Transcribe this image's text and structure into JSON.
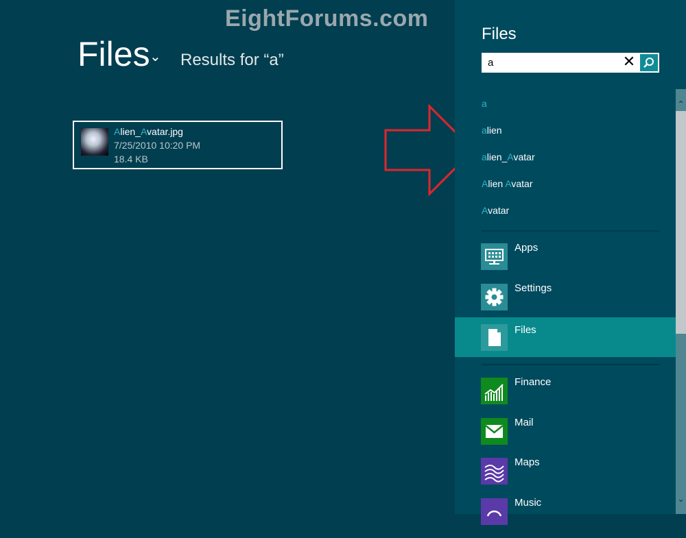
{
  "watermark": "EightForums.com",
  "main": {
    "title": "Files",
    "results_label": "Results for “a”",
    "file": {
      "name_hl1": "A",
      "name_mid": "lien_",
      "name_hl2": "A",
      "name_rest": "vatar.jpg",
      "date": "7/25/2010 10:20 PM",
      "size": "18.4 KB"
    }
  },
  "pane": {
    "title": "Files",
    "search_value": "a",
    "suggestions": [
      {
        "hl": "a",
        "rest": "",
        "hl2": "",
        "rest2": ""
      },
      {
        "hl": "a",
        "rest": "lien",
        "hl2": "",
        "rest2": ""
      },
      {
        "hl": "a",
        "rest": "lien_",
        "hl2": "A",
        "rest2": "vatar"
      },
      {
        "hl": "A",
        "rest": "lien ",
        "hl2": "A",
        "rest2": "vatar"
      },
      {
        "hl": "A",
        "rest": "vatar",
        "hl2": "",
        "rest2": ""
      }
    ],
    "targets": [
      {
        "label": "Apps",
        "icon": "apps-icon"
      },
      {
        "label": "Settings",
        "icon": "gear-icon"
      },
      {
        "label": "Files",
        "icon": "file-icon",
        "selected": true
      }
    ],
    "apps": [
      {
        "label": "Finance",
        "color": "#0f8a1e"
      },
      {
        "label": "Mail",
        "color": "#0f8a1e"
      },
      {
        "label": "Maps",
        "color": "#5a3aa8"
      },
      {
        "label": "Music",
        "color": "#5a3aa8"
      }
    ]
  },
  "colors": {
    "background": "#013e50",
    "pane": "#004a5e",
    "selected": "#088a8d",
    "highlight": "#2fb4c4",
    "arrow": "#e0262b"
  }
}
